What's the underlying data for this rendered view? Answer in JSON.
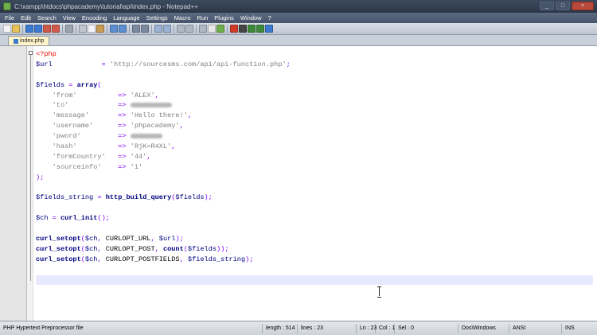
{
  "window": {
    "title": "C:\\xampp\\htdocs\\phpacademy\\tutorial\\api\\index.php - Notepad++"
  },
  "menu": [
    "File",
    "Edit",
    "Search",
    "View",
    "Encoding",
    "Language",
    "Settings",
    "Macro",
    "Run",
    "Plugins",
    "Window",
    "?"
  ],
  "toolbar_icons": [
    {
      "name": "new-file-icon",
      "color": "#f3f3f3"
    },
    {
      "name": "open-folder-icon",
      "color": "#e8c35a"
    },
    {
      "name": "save-icon",
      "color": "#3c7ad1"
    },
    {
      "name": "save-all-icon",
      "color": "#3c7ad1"
    },
    {
      "name": "close-file-icon",
      "color": "#d05a4a"
    },
    {
      "name": "close-all-icon",
      "color": "#d05a4a"
    },
    {
      "name": "print-icon",
      "color": "#9aa3b0"
    },
    {
      "name": "cut-icon",
      "color": "#c0c6cf"
    },
    {
      "name": "copy-icon",
      "color": "#f3f3f3"
    },
    {
      "name": "paste-icon",
      "color": "#c99a52"
    },
    {
      "name": "undo-icon",
      "color": "#5c8ed1"
    },
    {
      "name": "redo-icon",
      "color": "#5c8ed1"
    },
    {
      "name": "find-icon",
      "color": "#7c8aa0"
    },
    {
      "name": "replace-icon",
      "color": "#7c8aa0"
    },
    {
      "name": "zoom-in-icon",
      "color": "#9ab2d4"
    },
    {
      "name": "zoom-out-icon",
      "color": "#9ab2d4"
    },
    {
      "name": "sync-v-icon",
      "color": "#b0b8c4"
    },
    {
      "name": "sync-h-icon",
      "color": "#b0b8c4"
    },
    {
      "name": "word-wrap-icon",
      "color": "#b0b8c4"
    },
    {
      "name": "show-all-chars-icon",
      "color": "#e7e7e7"
    },
    {
      "name": "indent-guide-icon",
      "color": "#6fae4b"
    },
    {
      "name": "macro-record-icon",
      "color": "#d23a2a"
    },
    {
      "name": "macro-stop-icon",
      "color": "#444444"
    },
    {
      "name": "macro-play-icon",
      "color": "#3f8a3a"
    },
    {
      "name": "macro-play-multiple-icon",
      "color": "#3f8a3a"
    },
    {
      "name": "macro-save-icon",
      "color": "#3c7ad1"
    }
  ],
  "tab": {
    "label": "index.php"
  },
  "code_lines": [
    [
      {
        "c": "tag",
        "t": "<?php"
      }
    ],
    [
      {
        "c": "var",
        "t": "$url"
      },
      {
        "c": "",
        "t": "            "
      },
      {
        "c": "op",
        "t": "="
      },
      {
        "c": "",
        "t": " "
      },
      {
        "c": "str",
        "t": "'http://sourcesms.com/api/api-function.php'"
      },
      {
        "c": "op",
        "t": ";"
      }
    ],
    [],
    [
      {
        "c": "var",
        "t": "$fields"
      },
      {
        "c": "",
        "t": " "
      },
      {
        "c": "op",
        "t": "="
      },
      {
        "c": "",
        "t": " "
      },
      {
        "c": "kw",
        "t": "array"
      },
      {
        "c": "op",
        "t": "("
      }
    ],
    [
      {
        "c": "",
        "t": "    "
      },
      {
        "c": "str",
        "t": "'from'"
      },
      {
        "c": "",
        "t": "          "
      },
      {
        "c": "op",
        "t": "=>"
      },
      {
        "c": "",
        "t": " "
      },
      {
        "c": "str",
        "t": "'ALEX'"
      },
      {
        "c": "op",
        "t": ","
      }
    ],
    [
      {
        "c": "",
        "t": "    "
      },
      {
        "c": "str",
        "t": "'to'"
      },
      {
        "c": "",
        "t": "            "
      },
      {
        "c": "op",
        "t": "=>"
      },
      {
        "c": "",
        "t": " "
      },
      {
        "c": "blur",
        "t": ""
      }
    ],
    [
      {
        "c": "",
        "t": "    "
      },
      {
        "c": "str",
        "t": "'message'"
      },
      {
        "c": "",
        "t": "       "
      },
      {
        "c": "op",
        "t": "=>"
      },
      {
        "c": "",
        "t": " "
      },
      {
        "c": "str",
        "t": "'Hello there!'"
      },
      {
        "c": "op",
        "t": ","
      }
    ],
    [
      {
        "c": "",
        "t": "    "
      },
      {
        "c": "str",
        "t": "'username'"
      },
      {
        "c": "",
        "t": "      "
      },
      {
        "c": "op",
        "t": "=>"
      },
      {
        "c": "",
        "t": " "
      },
      {
        "c": "str",
        "t": "'phpacademy'"
      },
      {
        "c": "op",
        "t": ","
      }
    ],
    [
      {
        "c": "",
        "t": "    "
      },
      {
        "c": "str",
        "t": "'pword'"
      },
      {
        "c": "",
        "t": "         "
      },
      {
        "c": "op",
        "t": "=>"
      },
      {
        "c": "",
        "t": " "
      },
      {
        "c": "blur",
        "t": ""
      }
    ],
    [
      {
        "c": "",
        "t": "    "
      },
      {
        "c": "str",
        "t": "'hash'"
      },
      {
        "c": "",
        "t": "          "
      },
      {
        "c": "op",
        "t": "=>"
      },
      {
        "c": "",
        "t": " "
      },
      {
        "c": "str",
        "t": "'RjK=R4XL'"
      },
      {
        "c": "op",
        "t": ","
      }
    ],
    [
      {
        "c": "",
        "t": "    "
      },
      {
        "c": "str",
        "t": "'formCountry'"
      },
      {
        "c": "",
        "t": "   "
      },
      {
        "c": "op",
        "t": "=>"
      },
      {
        "c": "",
        "t": " "
      },
      {
        "c": "str",
        "t": "'44'"
      },
      {
        "c": "op",
        "t": ","
      }
    ],
    [
      {
        "c": "",
        "t": "    "
      },
      {
        "c": "str",
        "t": "'sourceinfo'"
      },
      {
        "c": "",
        "t": "    "
      },
      {
        "c": "op",
        "t": "=>"
      },
      {
        "c": "",
        "t": " "
      },
      {
        "c": "str",
        "t": "'1'"
      }
    ],
    [
      {
        "c": "op",
        "t": ");"
      }
    ],
    [],
    [
      {
        "c": "var",
        "t": "$fields_string"
      },
      {
        "c": "",
        "t": " "
      },
      {
        "c": "op",
        "t": "="
      },
      {
        "c": "",
        "t": " "
      },
      {
        "c": "kw",
        "t": "http_build_query"
      },
      {
        "c": "op",
        "t": "("
      },
      {
        "c": "var",
        "t": "$fields"
      },
      {
        "c": "op",
        "t": ");"
      }
    ],
    [],
    [
      {
        "c": "var",
        "t": "$ch"
      },
      {
        "c": "",
        "t": " "
      },
      {
        "c": "op",
        "t": "="
      },
      {
        "c": "",
        "t": " "
      },
      {
        "c": "kw",
        "t": "curl_init"
      },
      {
        "c": "op",
        "t": "();"
      }
    ],
    [],
    [
      {
        "c": "kw",
        "t": "curl_setopt"
      },
      {
        "c": "op",
        "t": "("
      },
      {
        "c": "var",
        "t": "$ch"
      },
      {
        "c": "op",
        "t": ","
      },
      {
        "c": "",
        "t": " CURLOPT_URL"
      },
      {
        "c": "op",
        "t": ","
      },
      {
        "c": "",
        "t": " "
      },
      {
        "c": "var",
        "t": "$url"
      },
      {
        "c": "op",
        "t": ");"
      }
    ],
    [
      {
        "c": "kw",
        "t": "curl_setopt"
      },
      {
        "c": "op",
        "t": "("
      },
      {
        "c": "var",
        "t": "$ch"
      },
      {
        "c": "op",
        "t": ","
      },
      {
        "c": "",
        "t": " CURLOPT_POST"
      },
      {
        "c": "op",
        "t": ","
      },
      {
        "c": "",
        "t": " "
      },
      {
        "c": "kw",
        "t": "count"
      },
      {
        "c": "op",
        "t": "("
      },
      {
        "c": "var",
        "t": "$fields"
      },
      {
        "c": "op",
        "t": "));"
      }
    ],
    [
      {
        "c": "kw",
        "t": "curl_setopt"
      },
      {
        "c": "op",
        "t": "("
      },
      {
        "c": "var",
        "t": "$ch"
      },
      {
        "c": "op",
        "t": ","
      },
      {
        "c": "",
        "t": " CURLOPT_POSTFIELDS"
      },
      {
        "c": "op",
        "t": ","
      },
      {
        "c": "",
        "t": " "
      },
      {
        "c": "var",
        "t": "$fields_string"
      },
      {
        "c": "op",
        "t": ");"
      }
    ],
    [],
    []
  ],
  "current_line": 22,
  "status": {
    "file_type": "PHP Hypertext Preprocessor file",
    "length": "length : 514",
    "lines": "lines : 23",
    "ln": "Ln : 23",
    "col": "Col : 1",
    "sel": "Sel : 0",
    "eol": "Dos\\Windows",
    "encoding": "ANSI",
    "mode": "INS"
  }
}
